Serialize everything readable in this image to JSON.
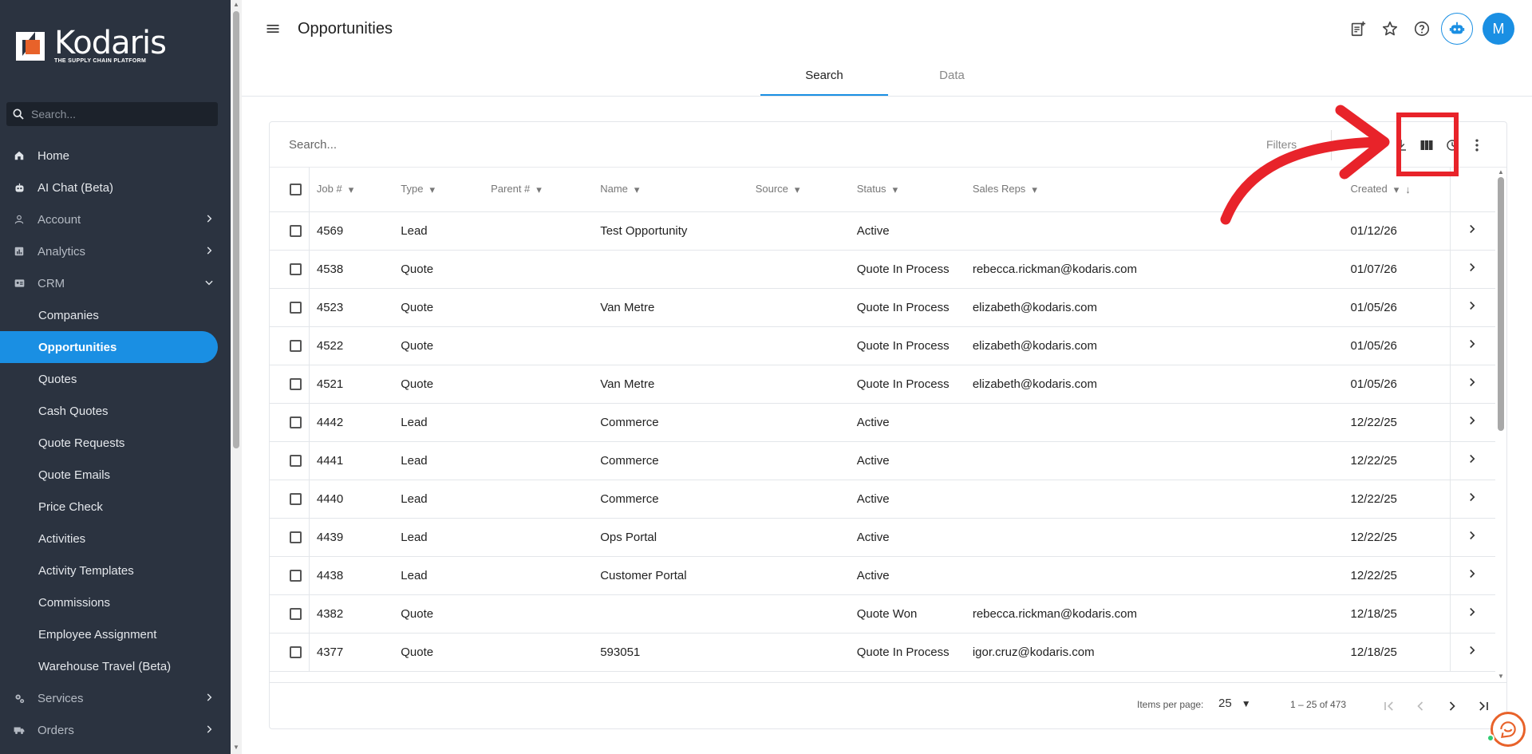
{
  "app": {
    "brand_name": "Kodaris",
    "brand_tagline": "THE SUPPLY CHAIN PLATFORM"
  },
  "sidebar": {
    "search_placeholder": "Search...",
    "items": [
      {
        "label": "Home",
        "icon": "home-icon"
      },
      {
        "label": "AI Chat (Beta)",
        "icon": "robot-icon"
      },
      {
        "label": "Account",
        "icon": "person-icon"
      },
      {
        "label": "Analytics",
        "icon": "chart-icon"
      },
      {
        "label": "CRM",
        "icon": "contact-card-icon"
      },
      {
        "label": "Companies"
      },
      {
        "label": "Opportunities"
      },
      {
        "label": "Quotes"
      },
      {
        "label": "Cash Quotes"
      },
      {
        "label": "Quote Requests"
      },
      {
        "label": "Quote Emails"
      },
      {
        "label": "Price Check"
      },
      {
        "label": "Activities"
      },
      {
        "label": "Activity Templates"
      },
      {
        "label": "Commissions"
      },
      {
        "label": "Employee Assignment"
      },
      {
        "label": "Warehouse Travel (Beta)"
      },
      {
        "label": "Services",
        "icon": "gears-icon"
      },
      {
        "label": "Orders",
        "icon": "truck-icon"
      }
    ]
  },
  "header": {
    "title": "Opportunities",
    "avatar_initial": "M",
    "tabs": [
      {
        "label": "Search",
        "active": true
      },
      {
        "label": "Data",
        "active": false
      }
    ]
  },
  "toolbar": {
    "search_placeholder": "Search...",
    "filters_label": "Filters"
  },
  "table": {
    "columns": [
      "Job #",
      "Type",
      "Parent #",
      "Name",
      "Source",
      "Status",
      "Sales Reps",
      "Created"
    ],
    "rows": [
      {
        "job": "4569",
        "type": "Lead",
        "parent": "",
        "name": "Test Opportunity",
        "source": "",
        "status": "Active",
        "reps": "",
        "created": "01/12/26"
      },
      {
        "job": "4538",
        "type": "Quote",
        "parent": "",
        "name": "",
        "source": "",
        "status": "Quote In Process",
        "reps": "rebecca.rickman@kodaris.com",
        "created": "01/07/26"
      },
      {
        "job": "4523",
        "type": "Quote",
        "parent": "",
        "name": "Van Metre",
        "source": "",
        "status": "Quote In Process",
        "reps": "elizabeth@kodaris.com",
        "created": "01/05/26"
      },
      {
        "job": "4522",
        "type": "Quote",
        "parent": "",
        "name": "",
        "source": "",
        "status": "Quote In Process",
        "reps": "elizabeth@kodaris.com",
        "created": "01/05/26"
      },
      {
        "job": "4521",
        "type": "Quote",
        "parent": "",
        "name": "Van Metre",
        "source": "",
        "status": "Quote In Process",
        "reps": "elizabeth@kodaris.com",
        "created": "01/05/26"
      },
      {
        "job": "4442",
        "type": "Lead",
        "parent": "",
        "name": "Commerce",
        "source": "",
        "status": "Active",
        "reps": "",
        "created": "12/22/25"
      },
      {
        "job": "4441",
        "type": "Lead",
        "parent": "",
        "name": "Commerce",
        "source": "",
        "status": "Active",
        "reps": "",
        "created": "12/22/25"
      },
      {
        "job": "4440",
        "type": "Lead",
        "parent": "",
        "name": "Commerce",
        "source": "",
        "status": "Active",
        "reps": "",
        "created": "12/22/25"
      },
      {
        "job": "4439",
        "type": "Lead",
        "parent": "",
        "name": "Ops Portal",
        "source": "",
        "status": "Active",
        "reps": "",
        "created": "12/22/25"
      },
      {
        "job": "4438",
        "type": "Lead",
        "parent": "",
        "name": "Customer Portal",
        "source": "",
        "status": "Active",
        "reps": "",
        "created": "12/22/25"
      },
      {
        "job": "4382",
        "type": "Quote",
        "parent": "",
        "name": "",
        "source": "",
        "status": "Quote Won",
        "reps": "rebecca.rickman@kodaris.com",
        "created": "12/18/25"
      },
      {
        "job": "4377",
        "type": "Quote",
        "parent": "",
        "name": "593051",
        "source": "",
        "status": "Quote In Process",
        "reps": "igor.cruz@kodaris.com",
        "created": "12/18/25"
      }
    ]
  },
  "pagination": {
    "items_per_page_label": "Items per page:",
    "items_per_page": "25",
    "range": "1 – 25 of 473"
  },
  "colors": {
    "sidebar_bg": "#2b3340",
    "accent": "#1a8fe3",
    "annotation": "#e8232a",
    "logo_orange": "#e8622a"
  }
}
